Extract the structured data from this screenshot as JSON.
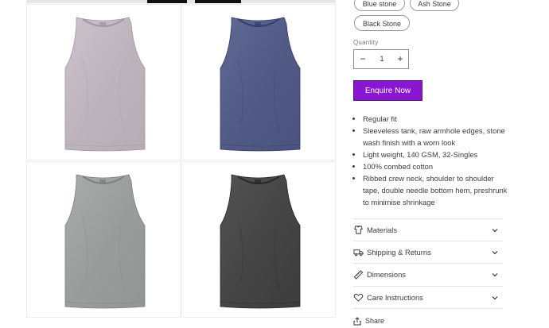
{
  "colors": {
    "accent": "#8a16d2",
    "shirt_ash": "#bdb4bd",
    "shirt_blue": "#525a86",
    "shirt_grey": "#9a9d9c",
    "shirt_black": "#454545"
  },
  "gallery": {
    "images": [
      {
        "name": "ash-stone-tank",
        "color_key": "shirt_ash"
      },
      {
        "name": "blue-stone-tank",
        "color_key": "shirt_blue"
      },
      {
        "name": "grey-stone-tank",
        "color_key": "shirt_grey"
      },
      {
        "name": "black-stone-tank",
        "color_key": "shirt_black"
      }
    ]
  },
  "variants": {
    "options": [
      "Blue stone",
      "Ash Stone",
      "Black Stone"
    ]
  },
  "quantity": {
    "label": "Quantity",
    "value": "1",
    "minus": "−",
    "plus": "+"
  },
  "enquire": {
    "label": "Enquire Now"
  },
  "features": [
    "Regular fit",
    "Sleeveless tank, raw armhole edges, stone wash finish with a worn look",
    "Light weight, 140 GSM, 32-Singles",
    "100% combed cotton",
    "Ribbed crew neck, shoulder to shoulder tape, double needle bottom hem, preshrunk to minimise shrinkage"
  ],
  "accordions": [
    {
      "label": "Materials",
      "icon": "materials-icon"
    },
    {
      "label": "Shipping & Returns",
      "icon": "truck-icon"
    },
    {
      "label": "Dimensions",
      "icon": "ruler-icon"
    },
    {
      "label": "Care Instructions",
      "icon": "heart-icon"
    }
  ],
  "share": {
    "label": "Share",
    "icon": "share-icon"
  }
}
